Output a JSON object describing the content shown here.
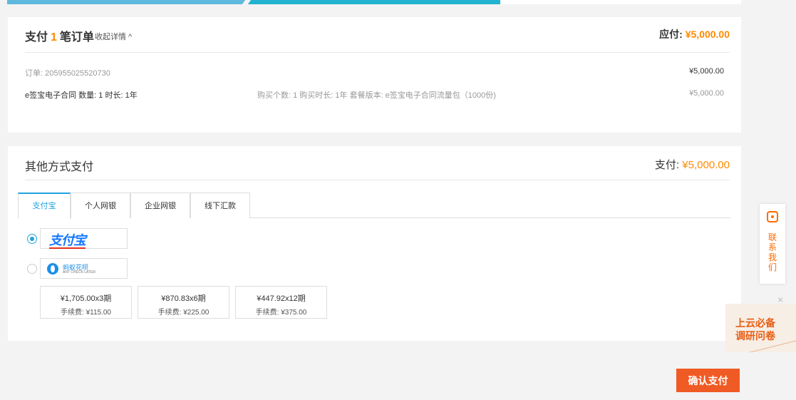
{
  "summary": {
    "title_prefix": "支付",
    "order_count": "1",
    "title_suffix": "笔订单",
    "collapse_label": "收起详情 ^",
    "due_label": "应付:",
    "due_amount": "¥5,000.00"
  },
  "order": {
    "number": "订单: 205955025520730",
    "total": "¥5,000.00",
    "item_name": "e签宝电子合同 数量: 1 时长: 1年",
    "item_spec": "购买个数: 1 购买时长: 1年 套餐版本: e签宝电子合同流量包（1000份)",
    "item_price": "¥5,000.00"
  },
  "other_pay": {
    "title": "其他方式支付",
    "pay_label": "支付:",
    "pay_amount": "¥5,000.00",
    "tabs": [
      "支付宝",
      "个人网银",
      "企业网银",
      "线下汇款"
    ],
    "active_tab": "支付宝",
    "alipay_logo_text": "支付宝",
    "huabei_logo_text": "蚂蚁花呗",
    "huabei_logo_sub": "ANT CHECK LATER",
    "installments": [
      {
        "amount": "¥1,705.00x3期",
        "fee": "手续费: ¥115.00"
      },
      {
        "amount": "¥870.83x6期",
        "fee": "手续费: ¥225.00"
      },
      {
        "amount": "¥447.92x12期",
        "fee": "手续费: ¥375.00"
      }
    ]
  },
  "sidebar": {
    "contact_label": "联系我们",
    "survey_close": "×",
    "survey_line1": "上云必备",
    "survey_line2": "调研问卷"
  },
  "actions": {
    "confirm_label": "确认支付"
  },
  "colors": {
    "accent": "#ff8a00",
    "primary_blue": "#21a3e0",
    "confirm_bg": "#f05a24",
    "progress_teal": "#21b3cf"
  }
}
